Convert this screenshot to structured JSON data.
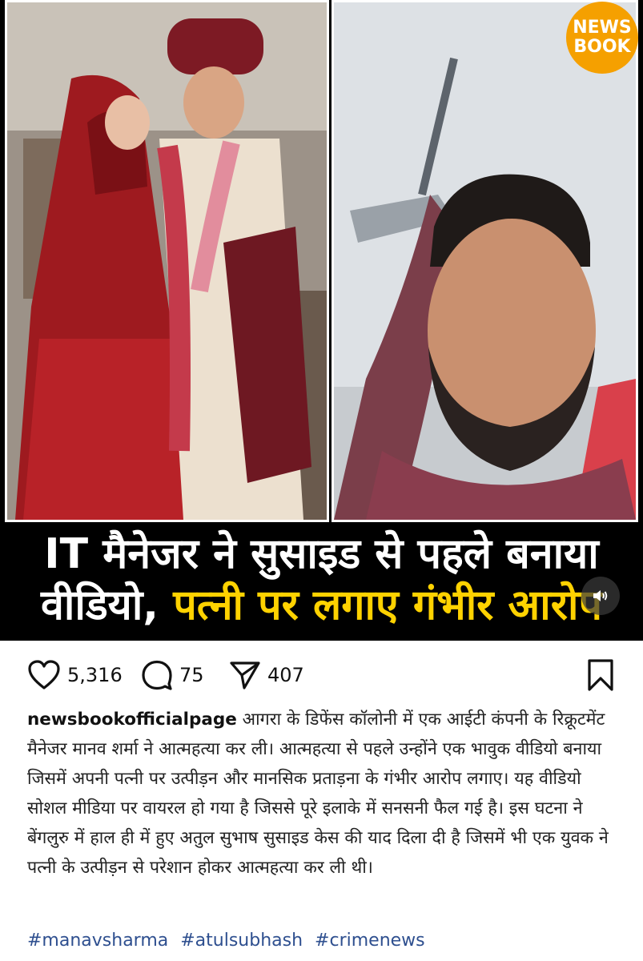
{
  "media": {
    "left_photo_desc": "wedding photo",
    "logo": {
      "line1": "NEWS",
      "line2": "BOOK"
    },
    "headline": {
      "line1": "IT मैनेजर ने सुसाइड से पहले बनाया",
      "line2_white": "वीडियो,",
      "line2_yellow": "पत्नी पर लगाए गंभीर आरोप"
    }
  },
  "actions": {
    "likes": "5,316",
    "comments": "75",
    "shares": "407"
  },
  "caption": {
    "username": "newsbookofficialpage",
    "text": "आगरा के डिफेंस कॉलोनी में एक आईटी कंपनी के रिक्रूटमेंट मैनेजर मानव शर्मा ने आत्महत्या कर ली। आत्महत्या से पहले उन्होंने एक भावुक वीडियो बनाया जिसमें अपनी पत्नी पर उत्पीड़न और मानसिक प्रताड़ना के गंभीर आरोप लगाए। यह वीडियो सोशल मीडिया पर वायरल हो गया है जिससे पूरे इलाके में सनसनी फैल गई है। इस घटना ने बेंगलुरु में हाल ही में हुए अतुल सुभाष सुसाइड केस की याद दिला दी है जिसमें भी एक युवक ने पत्नी के उत्पीड़न से परेशान होकर आत्महत्या कर ली थी।"
  },
  "hashtags": [
    "#manavsharma",
    "#atulsubhash",
    "#crimenews"
  ],
  "colors": {
    "accent_yellow": "#ffd200",
    "hashtag": "#2e4f8f",
    "logo": "#f5a000"
  }
}
